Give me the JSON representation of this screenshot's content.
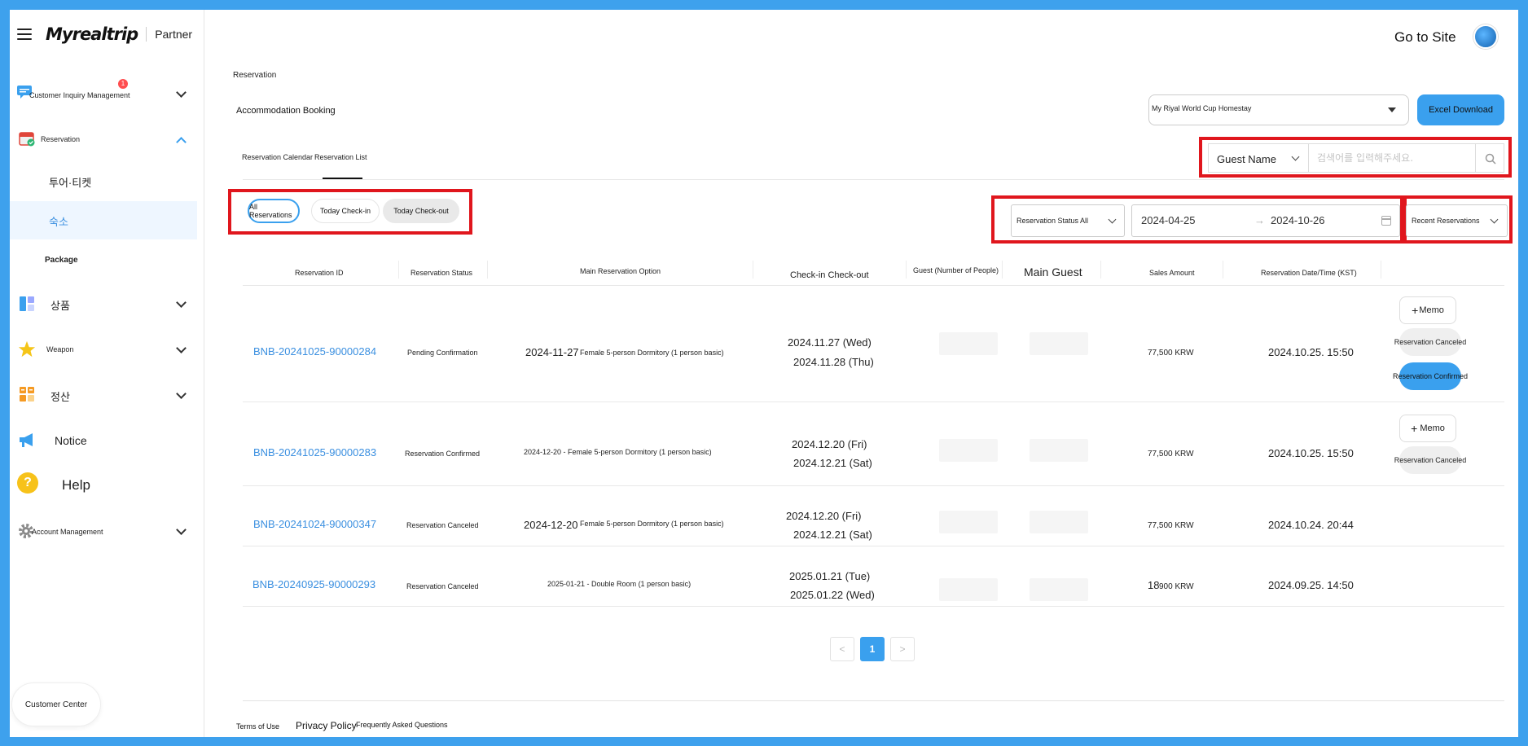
{
  "brand": {
    "logo": "Myrealtrip",
    "partner": "Partner"
  },
  "sidebar": {
    "items": [
      {
        "label": "Customer Inquiry Management",
        "icon": "chat-icon",
        "badge": "1"
      },
      {
        "label": "Reservation",
        "icon": "calendar-icon"
      },
      {
        "label": "투어·티켓"
      },
      {
        "label": "숙소"
      },
      {
        "label": "Package"
      },
      {
        "label": "상품",
        "icon": "dashboard-icon"
      },
      {
        "label": "Weapon",
        "icon": "star-icon"
      },
      {
        "label": "정산",
        "icon": "grid-icon"
      },
      {
        "label": "Notice",
        "icon": "megaphone-icon"
      },
      {
        "label": "Help",
        "icon": "help-icon"
      },
      {
        "label": "Account Management",
        "icon": "gear-icon"
      }
    ],
    "customer_center": "Customer Center"
  },
  "header": {
    "goto_site": "Go to Site"
  },
  "page": {
    "breadcrumb": "Reservation",
    "title": "Accommodation Booking",
    "property": "My Riyal World Cup Homestay",
    "excel": "Excel Download"
  },
  "tabs": [
    "Reservation Calendar",
    "Reservation List"
  ],
  "search": {
    "type": "Guest Name",
    "placeholder": "검색어를 입력해주세요."
  },
  "chips": [
    "All Reservations",
    "Today Check-in",
    "Today Check-out"
  ],
  "filters": {
    "status": "Reservation Status All",
    "start_date": "2024-04-25",
    "end_date": "2024-10-26",
    "sort": "Recent Reservations"
  },
  "table": {
    "headers": [
      "Reservation ID",
      "Reservation Status",
      "Main Reservation Option",
      "Check-in Check-out",
      "Guest (Number of People)",
      "Main Guest",
      "Sales Amount",
      "Reservation Date/Time (KST)"
    ],
    "rows": [
      {
        "id": "BNB-20241025-90000284",
        "status": "Pending Confirmation",
        "opt_date": "2024-11-27",
        "opt_text": "Female 5-person Dormitory (1 person basic)",
        "checkin": "2024.11.27 (Wed)",
        "checkout": "2024.11.28 (Thu)",
        "amount": "77,500 KRW",
        "datetime": "2024.10.25. 15:50",
        "memo": "Memo",
        "action1": "Reservation Canceled",
        "action2": "Reservation Confirmed"
      },
      {
        "id": "BNB-20241025-90000283",
        "status": "Reservation Confirmed",
        "opt_text": "2024-12-20 - Female 5-person Dormitory (1 person basic)",
        "checkin": "2024.12.20 (Fri)",
        "checkout": "2024.12.21 (Sat)",
        "amount": "77,500 KRW",
        "datetime": "2024.10.25. 15:50",
        "memo": "Memo",
        "action1": "Reservation Canceled"
      },
      {
        "id": "BNB-20241024-90000347",
        "status": "Reservation Canceled",
        "opt_date": "2024-12-20",
        "opt_text": "Female 5-person Dormitory (1 person basic)",
        "checkin": "2024.12.20 (Fri)",
        "checkout": "2024.12.21 (Sat)",
        "amount": "77,500 KRW",
        "datetime": "2024.10.24. 20:44"
      },
      {
        "id": "BNB-20240925-90000293",
        "status": "Reservation Canceled",
        "opt_text": "2025-01-21 - Double Room (1 person basic)",
        "checkin": "2025.01.21 (Tue)",
        "checkout": "2025.01.22 (Wed)",
        "amount_prefix": "18",
        "amount": "900 KRW",
        "datetime": "2024.09.25. 14:50"
      }
    ]
  },
  "pagination": {
    "current": "1",
    "prev": "<",
    "next": ">"
  },
  "footer": [
    "Terms of Use",
    "Privacy Policy",
    "Frequently Asked Questions"
  ],
  "colors": {
    "accent": "#3aa0ee",
    "frame": "#3ea1ed",
    "highlight": "#e0161d"
  }
}
